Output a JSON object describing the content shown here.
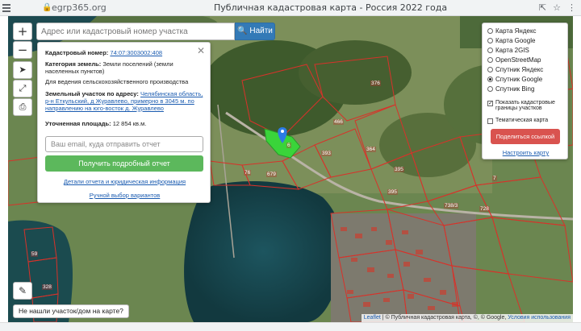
{
  "browser": {
    "url": "egrp365.org",
    "page_title": "Публичная кадастровая карта - Россия 2022 года"
  },
  "map": {
    "search_placeholder": "Адрес или кадастровый номер участка",
    "search_button": "Найти",
    "zoom_in": "+",
    "zoom_out": "−",
    "plot_labels": [
      "376",
      "466",
      "364",
      "395",
      "395",
      "393",
      "6",
      "679",
      "76",
      "738/3",
      "728",
      "328",
      "59",
      "7"
    ]
  },
  "info_panel": {
    "cadastral_label": "Кадастровый номер:",
    "cadastral_value": "74:07:3003002:408",
    "category_label": "Категория земель:",
    "category_value": "Земли поселений (земли населенных пунктов)",
    "usage": "Для ведения сельскохозяйственного производства",
    "address_label": "Земельный участок по адресу:",
    "address_value": "Челябинская область, р-н Еткульский, д Журавлево, примерно в 3045 м. по направлению на юго-восток д. Журавлево",
    "area_label": "Уточненная площадь:",
    "area_value": "12 854 кв.м.",
    "email_placeholder": "Ваш email, куда отправить отчет",
    "report_button": "Получить подробный отчет",
    "details_link": "Детали отчета и юридическая информация",
    "manual_link": "Ручной выбор вариантов"
  },
  "layers": {
    "options": [
      {
        "label": "Карта Яндекс",
        "selected": false
      },
      {
        "label": "Карта Google",
        "selected": false
      },
      {
        "label": "Карта 2GIS",
        "selected": false
      },
      {
        "label": "OpenStreetMap",
        "selected": false
      },
      {
        "label": "Спутник Яндекс",
        "selected": false
      },
      {
        "label": "Спутник Google",
        "selected": true
      },
      {
        "label": "Спутник Bing",
        "selected": false
      }
    ],
    "show_borders": "Показать кадастровые границы участков",
    "thematic_map": "Тематическая карта",
    "share_button": "Поделиться ссылкой",
    "setup_link": "Настроить карту"
  },
  "bottom": {
    "not_found": "Не нашли участок/дом на карте?",
    "attribution_leaflet": "Leaflet",
    "attribution_text": "| © Публичная кадастровая карта, ©, © Google,",
    "attribution_terms": "Условия использования"
  },
  "colors": {
    "accent_blue": "#337ab7",
    "green_button": "#5cb85c",
    "red_button": "#d9534f",
    "parcel_border": "#d8322a",
    "selected_parcel": "#3ad43a",
    "water": "#14424b"
  }
}
